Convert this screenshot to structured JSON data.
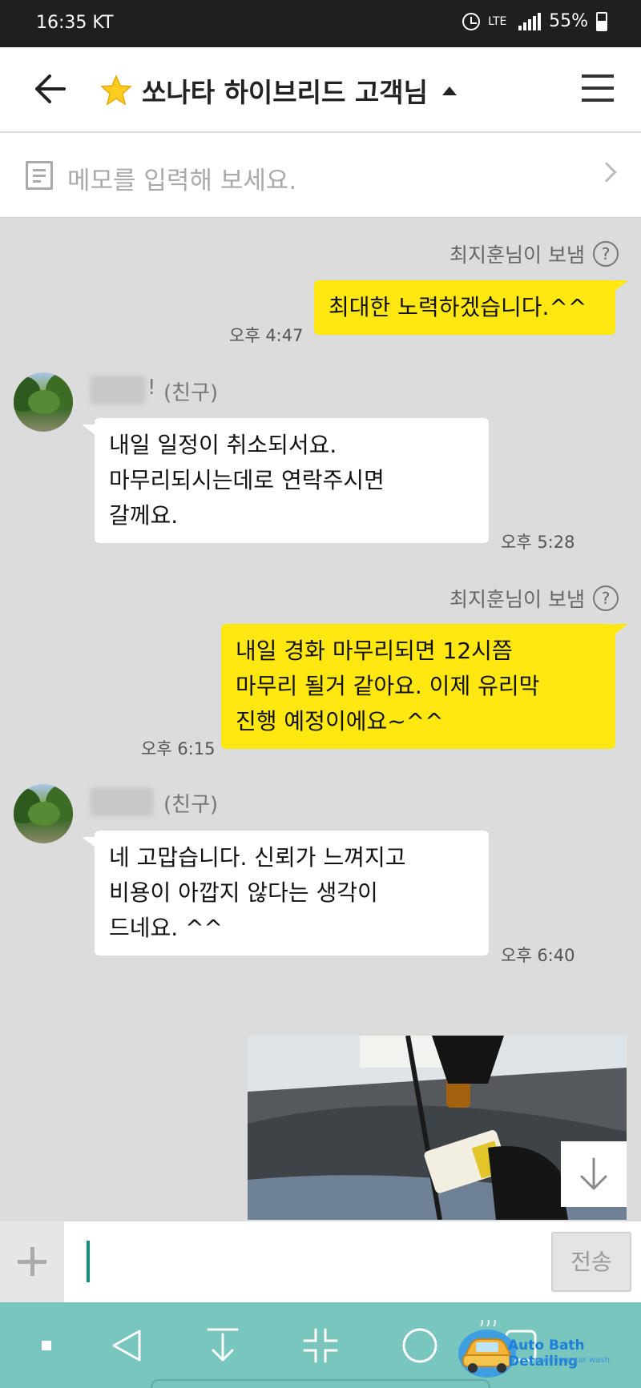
{
  "status_bar": {
    "time": "16:35 KT",
    "network": "LTE",
    "battery": "55%"
  },
  "header": {
    "title": "쏘나타 하이브리드 고객님"
  },
  "memo": {
    "placeholder": "메모를 입력해 보세요."
  },
  "messages": [
    {
      "sender_line": "최지훈님이 보냄",
      "text": "최대한 노력하겠습니다.^^",
      "time": "오후 4:47"
    },
    {
      "name_suffix": "!",
      "friend_tag": "(친구)",
      "text": "내일 일정이 취소되서요.\n마무리되시는데로 연락주시면\n갈께요.",
      "time": "오후 5:28"
    },
    {
      "sender_line": "최지훈님이 보냄",
      "text": "내일 경화 마무리되면 12시쯤\n마무리 될거 같아요. 이제 유리막\n진행 예정이에요~^^",
      "time": "오후 6:15"
    },
    {
      "friend_tag": "(친구)",
      "text": "네 고맙습니다. 신뢰가 느껴지고\n비용이 아깝지 않다는 생각이\n드네요. ^^",
      "time": "오후 6:40"
    }
  ],
  "input": {
    "send_label": "전송"
  },
  "watermark": {
    "name": "Auto Bath Detailing",
    "tagline": "premium car wash"
  },
  "colors": {
    "my_bubble": "#ffe812",
    "nav_bar": "#79c6bf",
    "cursor": "#1a8c7e"
  }
}
